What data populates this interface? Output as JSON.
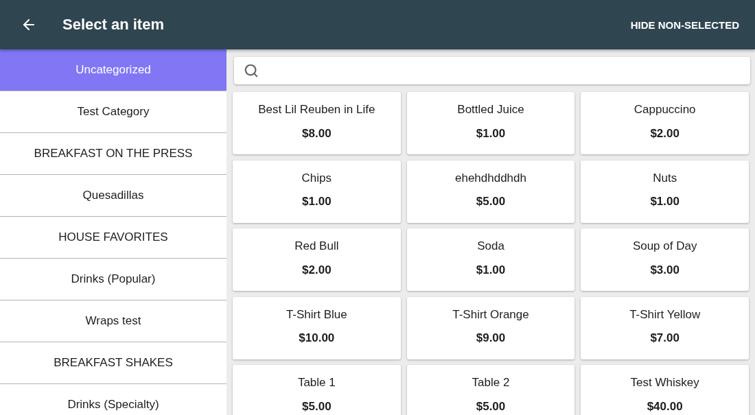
{
  "app_bar": {
    "title": "Select an item",
    "action": "HIDE NON-SELECTED"
  },
  "categories": [
    {
      "label": "Uncategorized",
      "selected": true
    },
    {
      "label": "Test Category",
      "selected": false
    },
    {
      "label": "BREAKFAST ON THE PRESS",
      "selected": false
    },
    {
      "label": "Quesadillas",
      "selected": false
    },
    {
      "label": "HOUSE FAVORITES",
      "selected": false
    },
    {
      "label": "Drinks (Popular)",
      "selected": false
    },
    {
      "label": "Wraps test",
      "selected": false
    },
    {
      "label": "BREAKFAST SHAKES",
      "selected": false
    },
    {
      "label": "Drinks (Specialty)",
      "selected": false
    }
  ],
  "items": [
    {
      "name": "Best Lil Reuben in Life",
      "price": "$8.00"
    },
    {
      "name": "Bottled Juice",
      "price": "$1.00"
    },
    {
      "name": "Cappuccino",
      "price": "$2.00"
    },
    {
      "name": "Chips",
      "price": "$1.00"
    },
    {
      "name": "ehehdhddhdh",
      "price": "$5.00"
    },
    {
      "name": "Nuts",
      "price": "$1.00"
    },
    {
      "name": "Red Bull",
      "price": "$2.00"
    },
    {
      "name": "Soda",
      "price": "$1.00"
    },
    {
      "name": "Soup of Day",
      "price": "$3.00"
    },
    {
      "name": "T-Shirt Blue",
      "price": "$10.00"
    },
    {
      "name": "T-Shirt Orange",
      "price": "$9.00"
    },
    {
      "name": "T-Shirt Yellow",
      "price": "$7.00"
    },
    {
      "name": "Table 1",
      "price": "$5.00"
    },
    {
      "name": "Table 2",
      "price": "$5.00"
    },
    {
      "name": "Test Whiskey",
      "price": "$40.00"
    }
  ]
}
